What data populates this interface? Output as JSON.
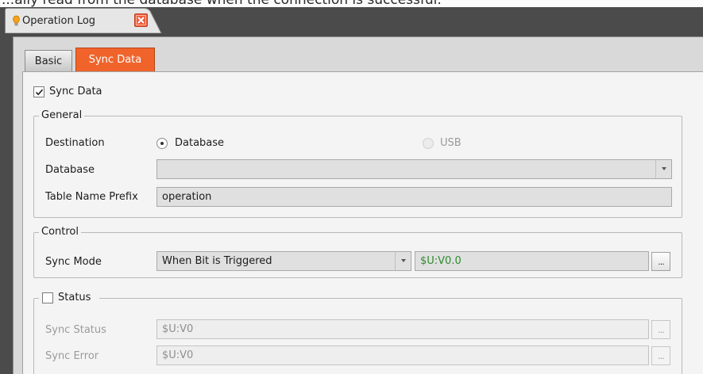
{
  "window": {
    "top_text": "...ally read from the database when the connection is successful.",
    "doc_tab_label": "Operation Log"
  },
  "tabs": [
    {
      "label": "Basic",
      "active": false
    },
    {
      "label": "Sync Data",
      "active": true
    }
  ],
  "accent_color": "#f0642c",
  "sync_data": {
    "label": "Sync Data",
    "checked": true
  },
  "general": {
    "legend": "General",
    "destination": {
      "label": "Destination",
      "options": [
        "Database",
        "USB"
      ],
      "selected": "Database"
    },
    "database": {
      "label": "Database",
      "value": ""
    },
    "table_prefix": {
      "label": "Table Name Prefix",
      "value": "operation"
    }
  },
  "control": {
    "legend": "Control",
    "sync_mode": {
      "label": "Sync Mode",
      "value": "When Bit is Triggered",
      "address": "$U:V0.0",
      "browse": "..."
    }
  },
  "status": {
    "legend": "Status",
    "checked": false,
    "sync_status": {
      "label": "Sync Status",
      "value": "$U:V0",
      "browse": "..."
    },
    "sync_error": {
      "label": "Sync Error",
      "value": "$U:V0",
      "browse": "..."
    }
  }
}
